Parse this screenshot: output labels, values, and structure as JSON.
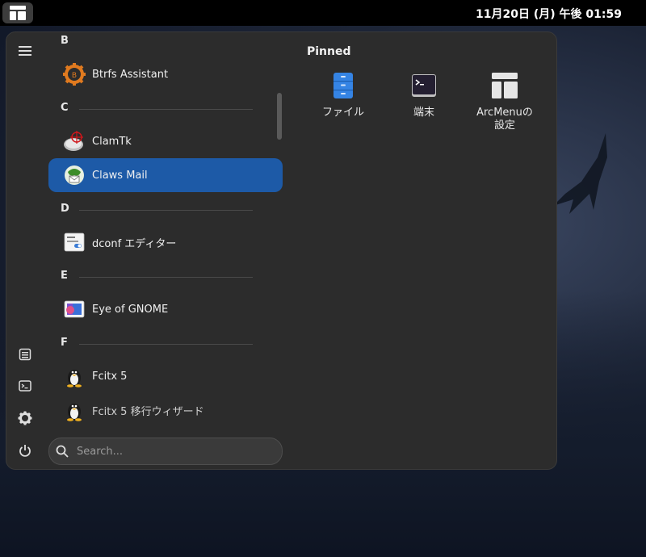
{
  "topbar": {
    "clock": "11月20日 (月) 午後 01:59"
  },
  "app_list": {
    "sections": [
      {
        "letter": "B"
      },
      {
        "letter": "C"
      },
      {
        "letter": "D"
      },
      {
        "letter": "E"
      },
      {
        "letter": "F"
      }
    ],
    "items": [
      {
        "label": "Btrfs Assistant",
        "icon": "btrfs-gear-icon"
      },
      {
        "label": "ClamTk",
        "icon": "clamtk-icon"
      },
      {
        "label": "Claws Mail",
        "icon": "claws-mail-icon",
        "selected": true
      },
      {
        "label": "dconf エディター",
        "icon": "dconf-editor-icon"
      },
      {
        "label": "Eye of GNOME",
        "icon": "eye-of-gnome-icon"
      },
      {
        "label": "Fcitx 5",
        "icon": "tux-icon"
      },
      {
        "label": "Fcitx 5 移行ウィザード",
        "icon": "tux-icon"
      }
    ]
  },
  "search": {
    "placeholder": "Search..."
  },
  "pinned": {
    "title": "Pinned",
    "apps": [
      {
        "label": "ファイル",
        "icon": "files-icon"
      },
      {
        "label": "端末",
        "icon": "terminal-icon"
      },
      {
        "label": "ArcMenuの設定",
        "icon": "arcmenu-settings-icon"
      }
    ]
  },
  "colors": {
    "selected": "#1d5aa7",
    "panel": "#2c2c2c"
  }
}
